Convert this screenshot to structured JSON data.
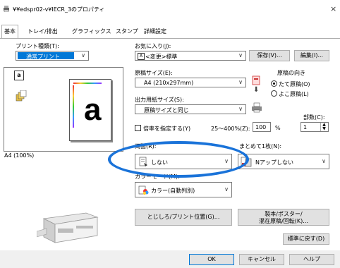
{
  "window": {
    "title": "¥¥edspr02-v¥IECR_3のプロパティ",
    "close": "×"
  },
  "tabs": [
    "基本",
    "トレイ/排出",
    "グラフィックス",
    "スタンプ",
    "詳細設定"
  ],
  "left": {
    "print_type_label": "プリント種類(T):",
    "print_type_value": "通常プリント",
    "preview_caption": "A4 (100%)",
    "preview_letter": "a"
  },
  "favorites": {
    "label": "お気に入り(J):",
    "value": "<変更>標準",
    "icon_text": "A",
    "save_label": "保存(V)...",
    "edit_label": "編集(I)..."
  },
  "original_size": {
    "label": "原稿サイズ(E):",
    "value": "A4 (210x297mm)"
  },
  "output_size": {
    "label": "出力用紙サイズ(S):",
    "value": "原稿サイズと同じ"
  },
  "orientation": {
    "label": "原稿の向き",
    "options": [
      "たて原稿(O)",
      "よこ原稿(L)"
    ],
    "selected": 0
  },
  "copies": {
    "label": "部数(C):",
    "value": "1"
  },
  "scale": {
    "check_label": "倍率を指定する(Y)",
    "range": "25〜400%(Z):",
    "value": "100",
    "unit": "%"
  },
  "duplex": {
    "label": "両面(R):",
    "value": "しない"
  },
  "nup": {
    "label": "まとめて1枚(N):",
    "value": "Nアップしない"
  },
  "color_mode": {
    "label": "カラーモード(M):",
    "value": "カラー(自動判別)"
  },
  "buttons": {
    "binding": "とじしろ/プリント位置(G)...",
    "booklet": [
      "製本/ポスター/",
      "混在原稿/回転(K)..."
    ],
    "restore": "標準に戻す(D)"
  },
  "footer": {
    "ok": "OK",
    "cancel": "キャンセル",
    "help": "ヘルプ"
  },
  "colors": {
    "highlight": "#0078d7",
    "annotation": "#1a73d9"
  }
}
